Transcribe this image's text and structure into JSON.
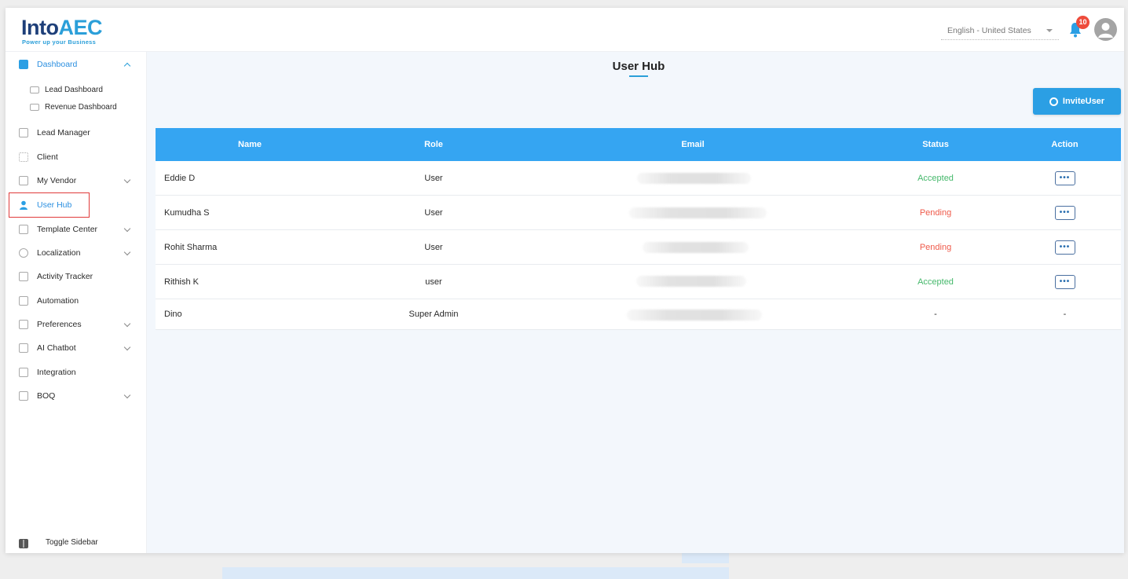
{
  "header": {
    "logo_main": "Into",
    "logo_accent": "AEC",
    "logo_tagline": "Power up your Business",
    "language": "English - United States",
    "notification_count": "10"
  },
  "sidebar": {
    "items": [
      {
        "label": "Dashboard",
        "icon": "dashboard-icon",
        "expanded": true
      },
      {
        "label": "Lead Dashboard",
        "icon": "monitor-icon"
      },
      {
        "label": "Revenue Dashboard",
        "icon": "chart-icon"
      },
      {
        "label": "Lead Manager",
        "icon": "lead-icon"
      },
      {
        "label": "Client",
        "icon": "client-icon"
      },
      {
        "label": "My Vendor",
        "icon": "vendor-icon"
      },
      {
        "label": "User Hub",
        "icon": "user-icon",
        "active": true
      },
      {
        "label": "Template Center",
        "icon": "template-icon"
      },
      {
        "label": "Localization",
        "icon": "localization-icon"
      },
      {
        "label": "Activity Tracker",
        "icon": "activity-icon"
      },
      {
        "label": "Automation",
        "icon": "automation-icon"
      },
      {
        "label": "Preferences",
        "icon": "preferences-icon"
      },
      {
        "label": "AI Chatbot",
        "icon": "chatbot-icon"
      },
      {
        "label": "Integration",
        "icon": "integration-icon"
      },
      {
        "label": "BOQ",
        "icon": "boq-icon"
      }
    ],
    "toggle_label": "Toggle Sidebar"
  },
  "main": {
    "title": "User Hub",
    "invite_label": "InviteUser",
    "columns": [
      "Name",
      "Role",
      "Email",
      "Status",
      "Action"
    ],
    "rows": [
      {
        "name": "Eddie D",
        "role": "User",
        "email": "",
        "status": "Accepted",
        "action": "•••"
      },
      {
        "name": "Kumudha S",
        "role": "User",
        "email": "",
        "status": "Pending",
        "action": "•••"
      },
      {
        "name": "Rohit  Sharma",
        "role": "User",
        "email": "",
        "status": "Pending",
        "action": "•••"
      },
      {
        "name": "Rithish K",
        "role": "user",
        "email": "",
        "status": "Accepted",
        "action": "•••"
      },
      {
        "name": "Dino",
        "role": "Super Admin",
        "email": "",
        "status": "-",
        "action": "-"
      }
    ]
  },
  "colors": {
    "accent": "#2b9fe4",
    "table_header": "#35a5f2",
    "accepted": "#45b86b",
    "pending": "#ef5a4a",
    "highlight_border": "#e03b3b"
  }
}
